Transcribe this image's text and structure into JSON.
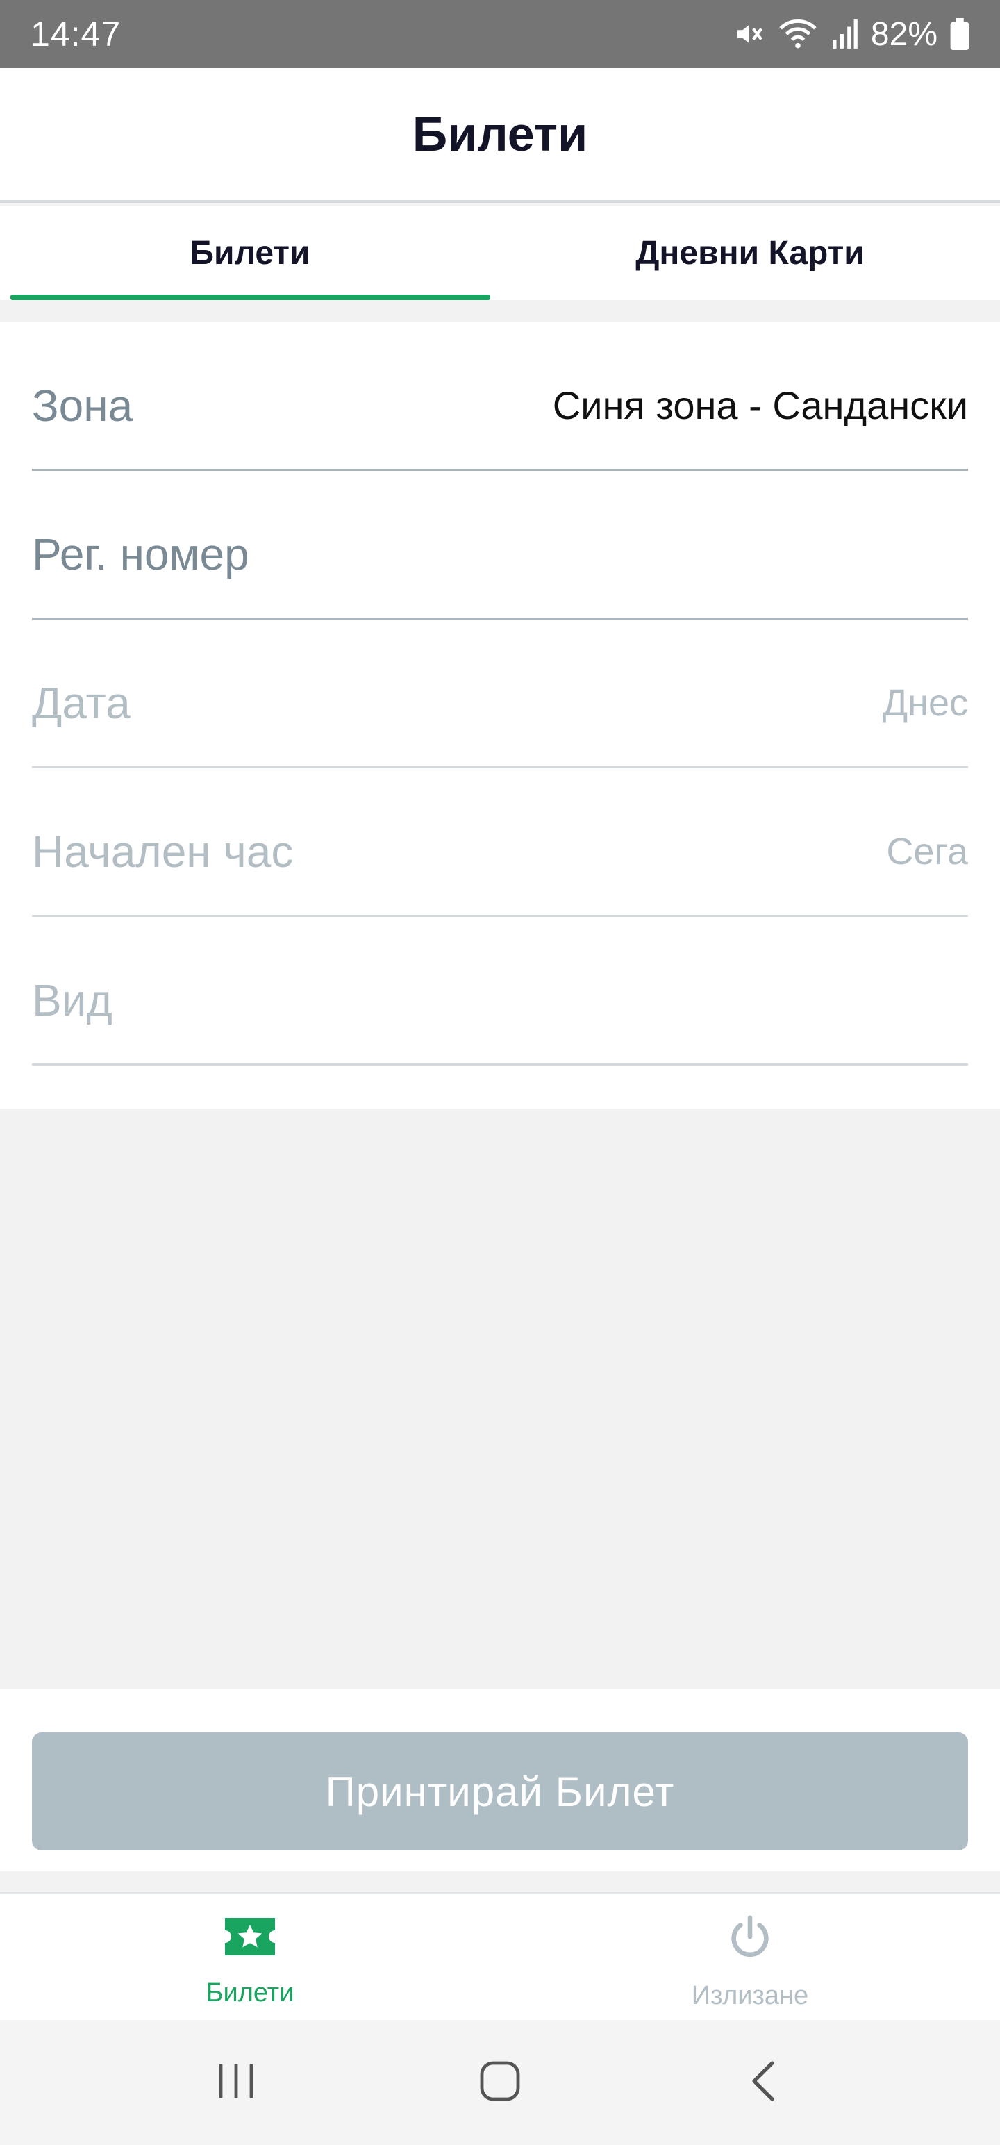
{
  "status_bar": {
    "time": "14:47",
    "battery": "82%",
    "icons": [
      "mute-icon",
      "wifi-icon",
      "signal-icon",
      "battery-icon"
    ]
  },
  "header": {
    "title": "Билети"
  },
  "tabs": [
    {
      "label": "Билети",
      "active": true
    },
    {
      "label": "Дневни Карти",
      "active": false
    }
  ],
  "form": {
    "zone": {
      "label": "Зона",
      "value": "Синя зона - Сандански"
    },
    "reg_number": {
      "placeholder": "Рег. номер"
    },
    "date": {
      "label": "Дата",
      "value": "Днес"
    },
    "start_time": {
      "label": "Начален час",
      "value": "Сега"
    },
    "type": {
      "label": "Вид"
    }
  },
  "print_button": {
    "label": "Принтирай Билет"
  },
  "bottom_nav": [
    {
      "label": "Билети",
      "icon": "ticket-icon",
      "active": true
    },
    {
      "label": "Излизане",
      "icon": "power-icon",
      "active": false
    }
  ],
  "colors": {
    "accent": "#19a560",
    "button_disabled": "#aebec4",
    "status_bar": "#757575"
  }
}
